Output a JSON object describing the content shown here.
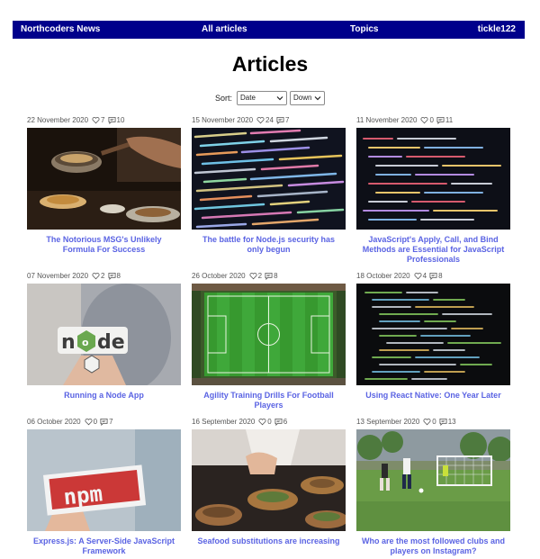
{
  "nav": {
    "brand": "Northcoders News",
    "all_articles": "All articles",
    "topics": "Topics",
    "user": "tickle122"
  },
  "page": {
    "title": "Articles"
  },
  "sort": {
    "label": "Sort:",
    "by": "Date",
    "direction": "Down"
  },
  "colors": {
    "nav_bg": "#00008b",
    "link": "#5a63e3"
  },
  "articles": [
    {
      "date": "22 November 2020",
      "likes": "7",
      "comments": "10",
      "title": "The Notorious MSG's Unlikely Formula For Success",
      "image": "wok-cooking-photo"
    },
    {
      "date": "15 November 2020",
      "likes": "24",
      "comments": "7",
      "title": "The battle for Node.js security has only begun",
      "image": "code-screen-photo"
    },
    {
      "date": "11 November 2020",
      "likes": "0",
      "comments": "11",
      "title": "JavaScript's Apply, Call, and Bind Methods are Essential for JavaScript Professionals",
      "image": "code-screen-photo"
    },
    {
      "date": "07 November 2020",
      "likes": "2",
      "comments": "8",
      "title": "Running a Node App",
      "image": "node-sticker-photo"
    },
    {
      "date": "26 October 2020",
      "likes": "2",
      "comments": "8",
      "title": "Agility Training Drills For Football Players",
      "image": "football-pitch-photo"
    },
    {
      "date": "18 October 2020",
      "likes": "4",
      "comments": "8",
      "title": "Using React Native: One Year Later",
      "image": "terminal-code-photo"
    },
    {
      "date": "06 October 2020",
      "likes": "0",
      "comments": "7",
      "title": "Express.js: A Server-Side JavaScript Framework",
      "image": "npm-sticker-photo"
    },
    {
      "date": "16 September 2020",
      "likes": "0",
      "comments": "6",
      "title": "Seafood substitutions are increasing",
      "image": "plated-food-photo"
    },
    {
      "date": "13 September 2020",
      "likes": "0",
      "comments": "13",
      "title": "Who are the most followed clubs and players on Instagram?",
      "image": "football-match-photo"
    }
  ]
}
